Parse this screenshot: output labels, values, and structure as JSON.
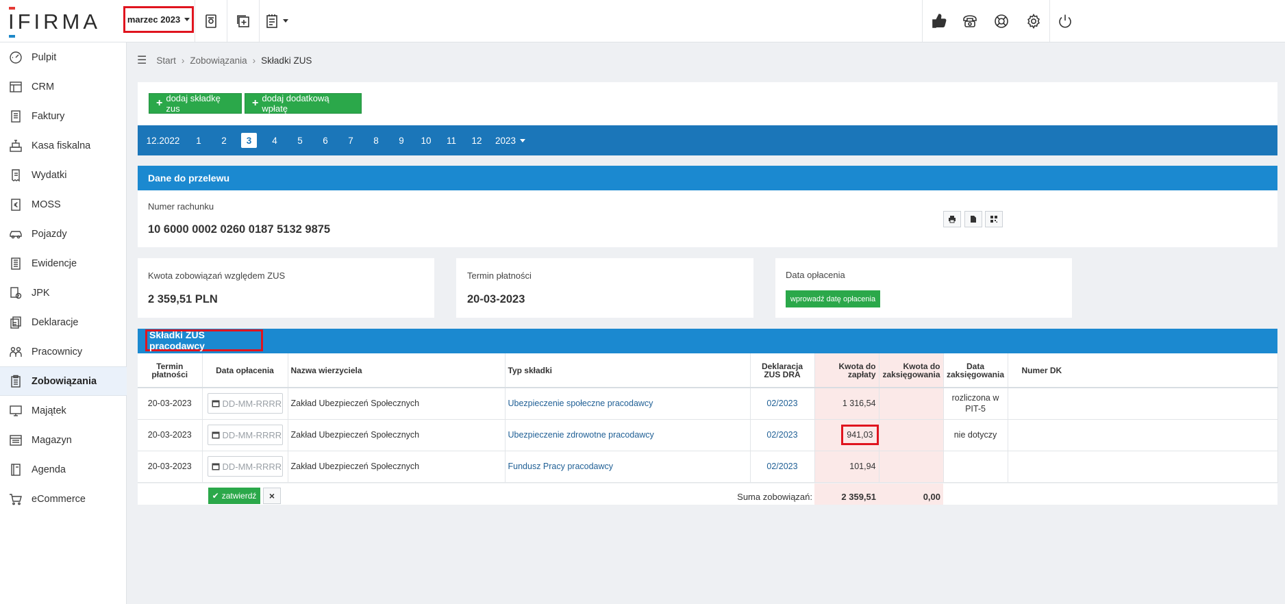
{
  "app": {
    "logo": "IFIRMA"
  },
  "topbar": {
    "month_selector": "marzec 2023",
    "icons": [
      "receipt-icon",
      "add-document-icon",
      "notes-icon",
      "thumbs-up-icon",
      "phone-icon",
      "lifebuoy-icon",
      "gear-icon",
      "power-icon"
    ]
  },
  "sidebar": {
    "items": [
      {
        "label": "Pulpit",
        "icon": "dashboard-icon"
      },
      {
        "label": "CRM",
        "icon": "crm-icon"
      },
      {
        "label": "Faktury",
        "icon": "invoice-icon"
      },
      {
        "label": "Kasa fiskalna",
        "icon": "cash-register-icon"
      },
      {
        "label": "Wydatki",
        "icon": "expense-icon"
      },
      {
        "label": "MOSS",
        "icon": "euro-icon"
      },
      {
        "label": "Pojazdy",
        "icon": "car-icon"
      },
      {
        "label": "Ewidencje",
        "icon": "register-icon"
      },
      {
        "label": "JPK",
        "icon": "jpk-icon"
      },
      {
        "label": "Deklaracje",
        "icon": "declaration-icon"
      },
      {
        "label": "Pracownicy",
        "icon": "employees-icon"
      },
      {
        "label": "Zobowiązania",
        "icon": "liabilities-icon",
        "active": true
      },
      {
        "label": "Majątek",
        "icon": "monitor-icon"
      },
      {
        "label": "Magazyn",
        "icon": "warehouse-icon"
      },
      {
        "label": "Agenda",
        "icon": "agenda-icon"
      },
      {
        "label": "eCommerce",
        "icon": "cart-icon"
      }
    ]
  },
  "breadcrumb": {
    "items": [
      "Start",
      "Zobowiązania"
    ],
    "current": "Składki ZUS"
  },
  "actions": {
    "add_zus": "dodaj składkę zus",
    "add_payment": "dodaj dodatkową wpłatę"
  },
  "monthbar": {
    "items": [
      "12.2022",
      "1",
      "2",
      "3",
      "4",
      "5",
      "6",
      "7",
      "8",
      "9",
      "10",
      "11",
      "12"
    ],
    "active": "3",
    "year": "2023"
  },
  "transfer": {
    "title": "Dane do przelewu",
    "account_label": "Numer rachunku",
    "account_number": "10 6000 0002 0260 0187 5132 9875"
  },
  "summary": {
    "amount_label": "Kwota zobowiązań względem ZUS",
    "amount_value": "2 359,51 PLN",
    "due_label": "Termin płatności",
    "due_value": "20-03-2023",
    "paid_label": "Data opłacenia",
    "paid_button": "wprowadź datę opłacenia"
  },
  "employer": {
    "title": "Składki ZUS pracodawcy",
    "columns": [
      "Termin płatności",
      "Data opłacenia",
      "Nazwa wierzyciela",
      "Typ składki",
      "Deklaracja ZUS DRA",
      "Kwota do zapłaty",
      "Kwota do zaksięgowania",
      "Data zaksięgowania",
      "Numer DK"
    ],
    "date_placeholder": "DD-MM-RRRR",
    "rows": [
      {
        "due": "20-03-2023",
        "creditor": "Zakład Ubezpieczeń Społecznych",
        "type": "Ubezpieczenie społeczne pracodawcy",
        "dra": "02/2023",
        "amount": "1 316,54",
        "to_book": "",
        "booked": "rozliczona w PIT-5",
        "dk": ""
      },
      {
        "due": "20-03-2023",
        "creditor": "Zakład Ubezpieczeń Społecznych",
        "type": "Ubezpieczenie zdrowotne pracodawcy",
        "dra": "02/2023",
        "amount": "941,03",
        "to_book": "",
        "booked": "nie dotyczy",
        "dk": ""
      },
      {
        "due": "20-03-2023",
        "creditor": "Zakład Ubezpieczeń Społecznych",
        "type": "Fundusz Pracy pracodawcy",
        "dra": "02/2023",
        "amount": "101,94",
        "to_book": "",
        "booked": "",
        "dk": ""
      }
    ],
    "confirm_button": "zatwierdź",
    "cancel_button": "×",
    "sum_label": "Suma zobowiązań:",
    "sum_amount": "2 359,51",
    "sum_to_book": "0,00"
  }
}
